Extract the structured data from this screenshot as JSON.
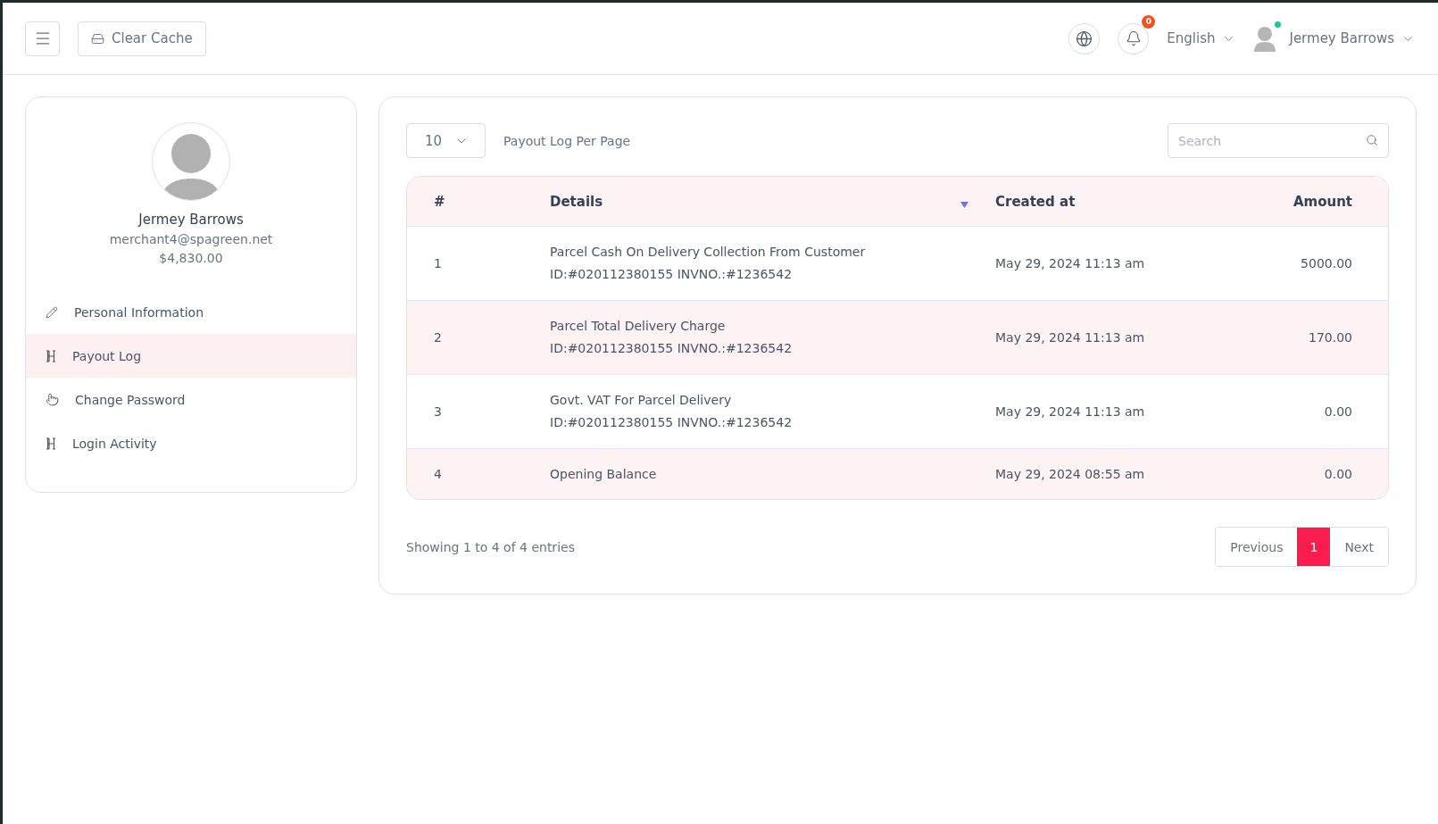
{
  "header": {
    "clear_cache": "Clear Cache",
    "notification_count": "0",
    "language": "English",
    "user_name": "Jermey Barrows",
    "user_online": true
  },
  "profile": {
    "name": "Jermey Barrows",
    "email": "merchant4@spagreen.net",
    "balance": "$4,830.00"
  },
  "sidebar": {
    "items": [
      {
        "label": "Personal Information",
        "selected": false
      },
      {
        "label": "Payout Log",
        "selected": true
      },
      {
        "label": "Change Password",
        "selected": false
      },
      {
        "label": "Login Activity",
        "selected": false
      }
    ]
  },
  "table_controls": {
    "per_page": "10",
    "per_page_label": "Payout Log Per Page",
    "search": {
      "placeholder": "Search"
    }
  },
  "table": {
    "columns": [
      "#",
      "Details",
      "Created at",
      "Amount"
    ],
    "rows": [
      {
        "index": "1",
        "details": [
          "Parcel Cash On Delivery Collection From Customer",
          "ID:#020112380155 INVNO.:#1236542"
        ],
        "created_at": "May 29, 2024 11:13 am",
        "amount": "5000.00"
      },
      {
        "index": "2",
        "details": [
          "Parcel Total Delivery Charge",
          "ID:#020112380155 INVNO.:#1236542"
        ],
        "created_at": "May 29, 2024 11:13 am",
        "amount": "170.00"
      },
      {
        "index": "3",
        "details": [
          "Govt. VAT For Parcel Delivery",
          "ID:#020112380155 INVNO.:#1236542"
        ],
        "created_at": "May 29, 2024 11:13 am",
        "amount": "0.00"
      },
      {
        "index": "4",
        "details": [
          "Opening Balance"
        ],
        "created_at": "May 29, 2024 08:55 am",
        "amount": "0.00"
      }
    ]
  },
  "footer": {
    "summary": "Showing 1 to 4 of 4 entries",
    "pagination": [
      {
        "label": "Previous",
        "kind": "nav",
        "selected": false
      },
      {
        "label": "1",
        "kind": "page",
        "selected": true
      },
      {
        "label": "Next",
        "kind": "nav",
        "selected": false
      }
    ]
  }
}
